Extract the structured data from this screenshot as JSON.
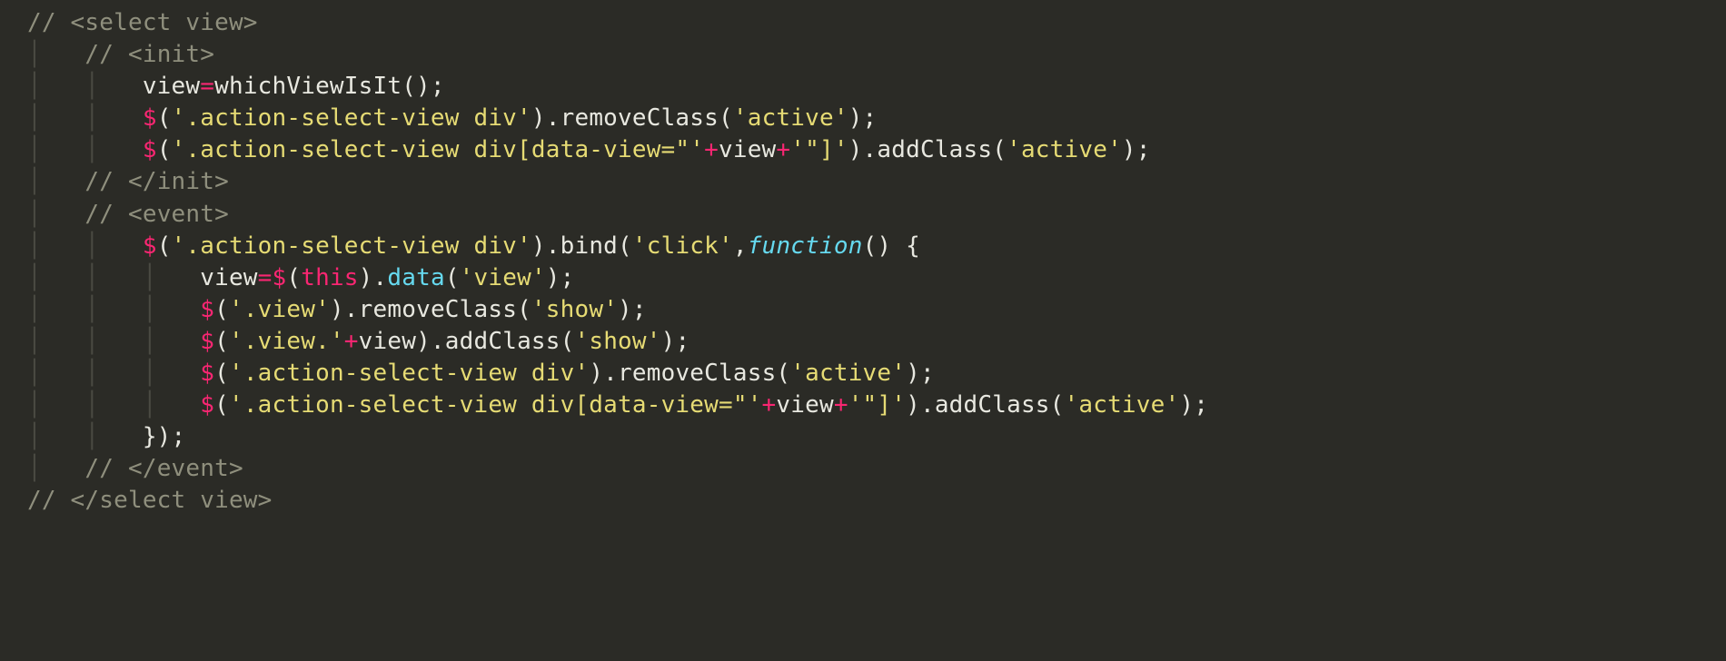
{
  "code": {
    "lines": [
      [
        {
          "cls": "cm",
          "t": "// <select view>"
        }
      ],
      [
        {
          "cls": "guide",
          "t": "│   "
        },
        {
          "cls": "cm",
          "t": "// <init>"
        }
      ],
      [
        {
          "cls": "guide",
          "t": "│   │   "
        },
        {
          "cls": "fn",
          "t": "view"
        },
        {
          "cls": "op",
          "t": "="
        },
        {
          "cls": "fn",
          "t": "whichViewIsIt"
        },
        {
          "cls": "pun",
          "t": "();"
        }
      ],
      [
        {
          "cls": "guide",
          "t": "│   │   "
        },
        {
          "cls": "dol",
          "t": "$"
        },
        {
          "cls": "pun",
          "t": "("
        },
        {
          "cls": "str",
          "t": "'.action-select-view div'"
        },
        {
          "cls": "pun",
          "t": ")."
        },
        {
          "cls": "fn",
          "t": "removeClass"
        },
        {
          "cls": "pun",
          "t": "("
        },
        {
          "cls": "str",
          "t": "'active'"
        },
        {
          "cls": "pun",
          "t": ");"
        }
      ],
      [
        {
          "cls": "guide",
          "t": "│   │   "
        },
        {
          "cls": "dol",
          "t": "$"
        },
        {
          "cls": "pun",
          "t": "("
        },
        {
          "cls": "str",
          "t": "'.action-select-view div[data-view=\"'"
        },
        {
          "cls": "op",
          "t": "+"
        },
        {
          "cls": "fn",
          "t": "view"
        },
        {
          "cls": "op",
          "t": "+"
        },
        {
          "cls": "str",
          "t": "'\"]'"
        },
        {
          "cls": "pun",
          "t": ")."
        },
        {
          "cls": "fn",
          "t": "addClass"
        },
        {
          "cls": "pun",
          "t": "("
        },
        {
          "cls": "str",
          "t": "'active'"
        },
        {
          "cls": "pun",
          "t": ");"
        }
      ],
      [
        {
          "cls": "guide",
          "t": "│   "
        },
        {
          "cls": "cm",
          "t": "// </init>"
        }
      ],
      [
        {
          "cls": "guide",
          "t": "│   "
        },
        {
          "cls": "cm",
          "t": "// <event>"
        }
      ],
      [
        {
          "cls": "guide",
          "t": "│   │   "
        },
        {
          "cls": "dol",
          "t": "$"
        },
        {
          "cls": "pun",
          "t": "("
        },
        {
          "cls": "str",
          "t": "'.action-select-view div'"
        },
        {
          "cls": "pun",
          "t": ")."
        },
        {
          "cls": "fn",
          "t": "bind"
        },
        {
          "cls": "pun",
          "t": "("
        },
        {
          "cls": "str",
          "t": "'click'"
        },
        {
          "cls": "pun",
          "t": ","
        },
        {
          "cls": "kw",
          "t": "function"
        },
        {
          "cls": "pun",
          "t": "() {"
        }
      ],
      [
        {
          "cls": "guide",
          "t": "│   │   │   "
        },
        {
          "cls": "fn",
          "t": "view"
        },
        {
          "cls": "op",
          "t": "="
        },
        {
          "cls": "dol",
          "t": "$"
        },
        {
          "cls": "pun",
          "t": "("
        },
        {
          "cls": "kw2",
          "t": "this"
        },
        {
          "cls": "pun",
          "t": ")."
        },
        {
          "cls": "mth",
          "t": "data"
        },
        {
          "cls": "pun",
          "t": "("
        },
        {
          "cls": "str",
          "t": "'view'"
        },
        {
          "cls": "pun",
          "t": ");"
        }
      ],
      [
        {
          "cls": "guide",
          "t": "│   │   │   "
        },
        {
          "cls": "dol",
          "t": "$"
        },
        {
          "cls": "pun",
          "t": "("
        },
        {
          "cls": "str",
          "t": "'.view'"
        },
        {
          "cls": "pun",
          "t": ")."
        },
        {
          "cls": "fn",
          "t": "removeClass"
        },
        {
          "cls": "pun",
          "t": "("
        },
        {
          "cls": "str",
          "t": "'show'"
        },
        {
          "cls": "pun",
          "t": ");"
        }
      ],
      [
        {
          "cls": "guide",
          "t": "│   │   │   "
        },
        {
          "cls": "dol",
          "t": "$"
        },
        {
          "cls": "pun",
          "t": "("
        },
        {
          "cls": "str",
          "t": "'.view.'"
        },
        {
          "cls": "op",
          "t": "+"
        },
        {
          "cls": "fn",
          "t": "view"
        },
        {
          "cls": "pun",
          "t": ")."
        },
        {
          "cls": "fn",
          "t": "addClass"
        },
        {
          "cls": "pun",
          "t": "("
        },
        {
          "cls": "str",
          "t": "'show'"
        },
        {
          "cls": "pun",
          "t": ");"
        }
      ],
      [
        {
          "cls": "guide",
          "t": "│   │   │   "
        },
        {
          "cls": "dol",
          "t": "$"
        },
        {
          "cls": "pun",
          "t": "("
        },
        {
          "cls": "str",
          "t": "'.action-select-view div'"
        },
        {
          "cls": "pun",
          "t": ")."
        },
        {
          "cls": "fn",
          "t": "removeClass"
        },
        {
          "cls": "pun",
          "t": "("
        },
        {
          "cls": "str",
          "t": "'active'"
        },
        {
          "cls": "pun",
          "t": ");"
        }
      ],
      [
        {
          "cls": "guide",
          "t": "│   │   │   "
        },
        {
          "cls": "dol",
          "t": "$"
        },
        {
          "cls": "pun",
          "t": "("
        },
        {
          "cls": "str",
          "t": "'.action-select-view div[data-view=\"'"
        },
        {
          "cls": "op",
          "t": "+"
        },
        {
          "cls": "fn",
          "t": "view"
        },
        {
          "cls": "op",
          "t": "+"
        },
        {
          "cls": "str",
          "t": "'\"]'"
        },
        {
          "cls": "pun",
          "t": ")."
        },
        {
          "cls": "fn",
          "t": "addClass"
        },
        {
          "cls": "pun",
          "t": "("
        },
        {
          "cls": "str",
          "t": "'active'"
        },
        {
          "cls": "pun",
          "t": ");"
        }
      ],
      [
        {
          "cls": "guide",
          "t": "│   │   "
        },
        {
          "cls": "pun",
          "t": "});"
        }
      ],
      [
        {
          "cls": "guide",
          "t": "│   "
        },
        {
          "cls": "cm",
          "t": "// </event>"
        }
      ],
      [
        {
          "cls": "cm",
          "t": "// </select view>"
        }
      ]
    ]
  }
}
